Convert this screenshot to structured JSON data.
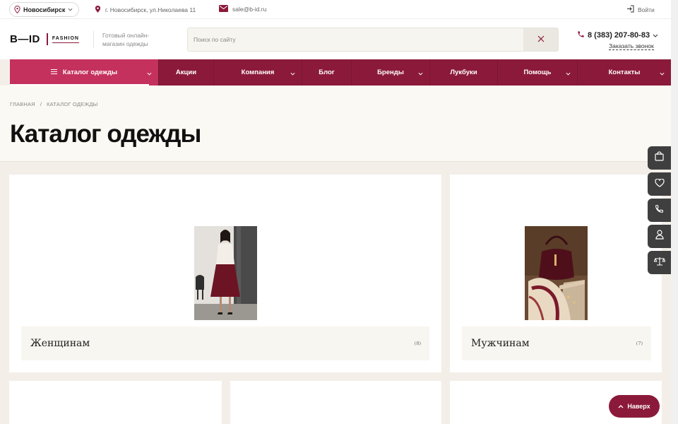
{
  "topbar": {
    "city": "Новосибирск",
    "address": "г. Новосибирск, ул.Николаева 11",
    "email": "sale@b-id.ru",
    "login": "Войти"
  },
  "header": {
    "logo_mark": "B—ID",
    "logo_sub": "FASHION",
    "tagline": "Готовый онлайн-магазин одежды",
    "search_placeholder": "Поиск по сайту",
    "phone": "8 (383) 207-80-83",
    "callback": "Заказать звонок"
  },
  "nav": {
    "items": [
      {
        "label": "Каталог одежды"
      },
      {
        "label": "Акции"
      },
      {
        "label": "Компания"
      },
      {
        "label": "Блог"
      },
      {
        "label": "Бренды"
      },
      {
        "label": "Лукбуки"
      },
      {
        "label": "Помощь"
      },
      {
        "label": "Контакты"
      }
    ]
  },
  "breadcrumb": {
    "home": "Главная",
    "separator": "/",
    "current": "Каталог одежды"
  },
  "page": {
    "title": "Каталог одежды"
  },
  "categories": [
    {
      "name": "Женщинам",
      "count": "(8)"
    },
    {
      "name": "Мужчинам",
      "count": "(7)"
    }
  ],
  "to_top": {
    "label": "Наверх"
  },
  "colors": {
    "brand": "#8b1a3a",
    "accent": "#c4315d",
    "page_bg": "#f3efe8",
    "panel_bg": "#fbf9f3",
    "side_btn": "#3f3f3f"
  },
  "icons": {
    "city": "map-pin-icon",
    "address": "map-pin-icon",
    "email": "mail-icon",
    "login": "login-icon",
    "clear": "close-icon",
    "phone": "phone-icon",
    "side": [
      "cart-icon",
      "heart-icon",
      "phone-icon",
      "user-icon",
      "scales-icon"
    ],
    "to_top": "chevron-up-icon"
  }
}
